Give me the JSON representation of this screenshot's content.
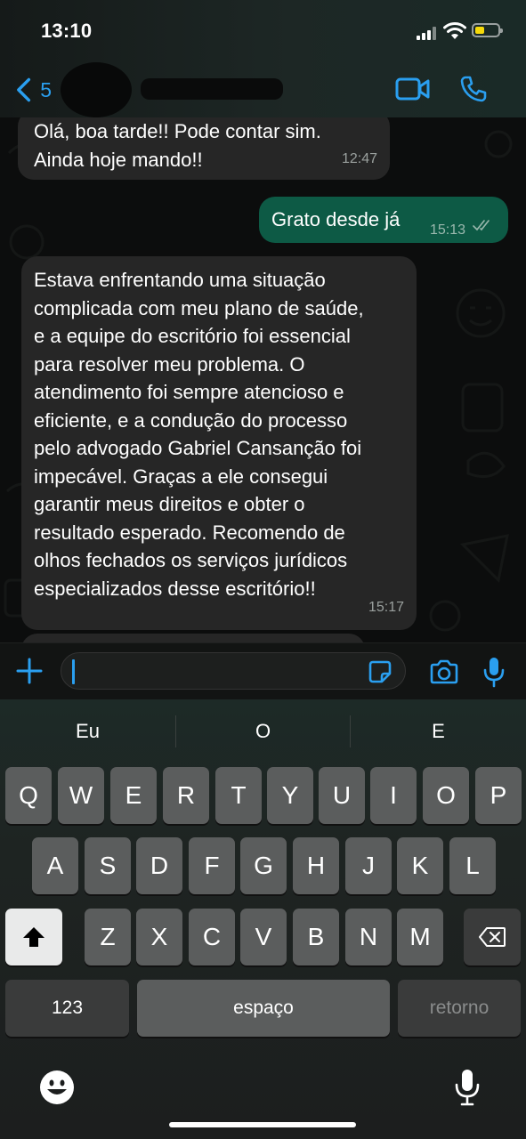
{
  "status_bar": {
    "time": "13:10"
  },
  "header": {
    "back_count": "5"
  },
  "messages": [
    {
      "direction": "in",
      "lines": [
        "Olá, boa tarde!! Pode contar sim.",
        "Ainda hoje mando!!"
      ],
      "time": "12:47"
    },
    {
      "direction": "out",
      "lines": [
        "Grato desde já"
      ],
      "time": "15:13",
      "read": true
    },
    {
      "direction": "in",
      "lines": [
        "Estava enfrentando uma situação",
        "complicada com meu plano de saúde,",
        "e a equipe do escritório foi essencial",
        "para resolver meu problema. O",
        "atendimento foi sempre atencioso e",
        "eficiente, e a condução do processo",
        "pelo advogado Gabriel Cansanção foi",
        "impecável. Graças a ele consegui",
        "garantir meus direitos e obter o",
        "resultado esperado. Recomendo de",
        "olhos fechados os serviços jurídicos",
        "especializados desse escritório!!"
      ],
      "time": "15:17"
    }
  ],
  "input": {
    "value": ""
  },
  "keyboard": {
    "suggestions": [
      "Eu",
      "O",
      "E"
    ],
    "row1": [
      "Q",
      "W",
      "E",
      "R",
      "T",
      "Y",
      "U",
      "I",
      "O",
      "P"
    ],
    "row2": [
      "A",
      "S",
      "D",
      "F",
      "G",
      "H",
      "J",
      "K",
      "L"
    ],
    "row3": [
      "Z",
      "X",
      "C",
      "V",
      "B",
      "N",
      "M"
    ],
    "numbers_label": "123",
    "space_label": "espaço",
    "return_label": "retorno"
  },
  "colors": {
    "accent": "#2a9ff0",
    "outgoing_bubble": "#0d5a45",
    "incoming_bubble": "#262626"
  }
}
